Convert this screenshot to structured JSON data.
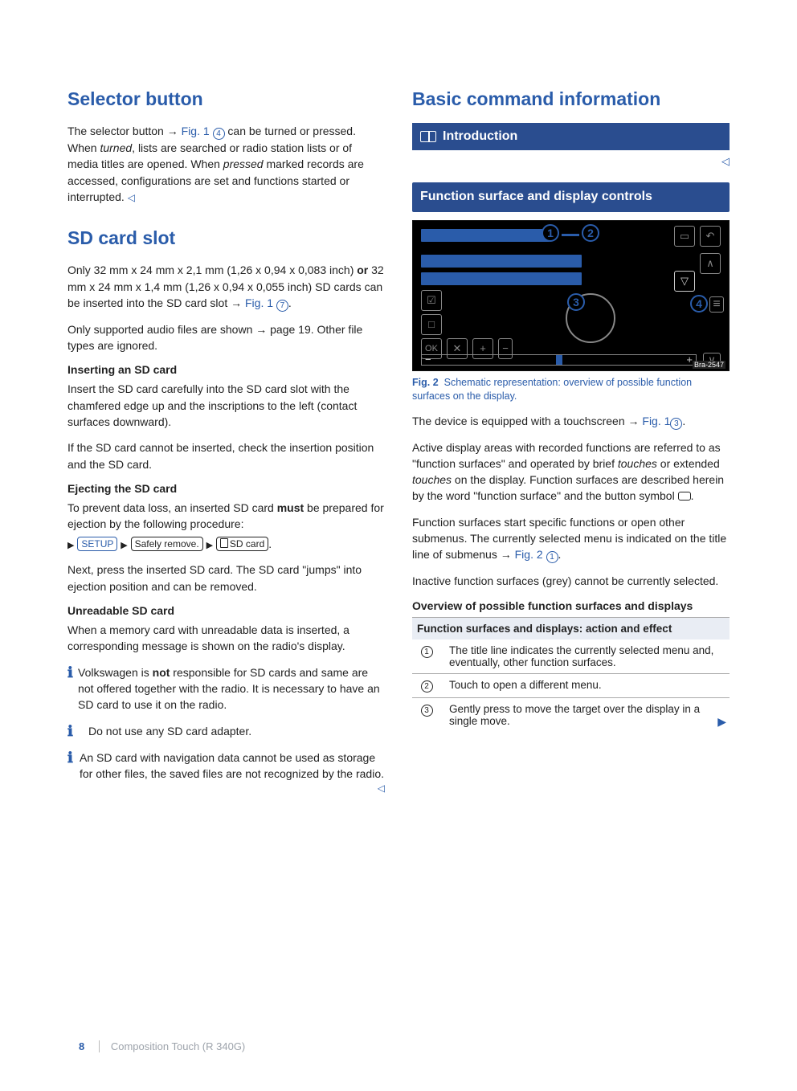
{
  "left": {
    "h_selector": "Selector button",
    "p_selector": "The selector button → Fig. 1 ④ can be turned or pressed. When turned, lists are searched or radio station lists or of media titles are opened. When pressed marked records are accessed, configurations are set and functions started or interrupted.",
    "p_selector_pre": "The selector button → ",
    "p_selector_figref": "Fig. 1",
    "p_selector_circ": "4",
    "p_selector_post": " can be turned or pressed. When ",
    "p_selector_it1": "turned",
    "p_selector_mid": ", lists are searched or radio station lists or of media titles are opened. When ",
    "p_selector_it2": "pressed",
    "p_selector_end": " marked records are accessed, configurations are set and functions started or interrupted. ",
    "h_sd": "SD card slot",
    "p_sd1_a": "Only 32 mm x 24 mm x 2,1 mm (1,26 x 0,94 x 0,083 inch) ",
    "p_sd1_or": "or",
    "p_sd1_b": " 32 mm x 24 mm x 1,4 mm (1,26 x 0,94 x 0,055 inch) SD cards can be inserted into the SD card slot → ",
    "p_sd1_fig": "Fig. 1",
    "p_sd1_circ": "7",
    "p_sd2": "Only supported audio files are shown → page 19. Other file types are ignored.",
    "sub_insert": "Inserting an SD card",
    "p_insert": "Insert the SD card carefully into the SD card slot with the chamfered edge up and the inscriptions to the left (contact surfaces downward).",
    "p_insert2": "If the SD card cannot be inserted, check the insertion position and the SD card.",
    "sub_eject": "Ejecting the SD card",
    "p_eject1_a": "To prevent data loss, an inserted SD card ",
    "p_eject1_must": "must",
    "p_eject1_b": " be prepared for ejection by the following procedure:",
    "btn_setup": "SETUP",
    "btn_safely": "Safely remove.",
    "btn_sdcard": "SD card",
    "p_eject2": "Next, press the inserted SD card. The SD card \"jumps\" into ejection position and can be removed.",
    "sub_unread": "Unreadable SD card",
    "p_unread": "When a memory card with unreadable data is inserted, a corresponding message is shown on the radio's display.",
    "note1_a": "Volkswagen is ",
    "note1_not": "not",
    "note1_b": " responsible for SD cards and same are not offered together with the radio. It is necessary to have an SD card to use it on the radio.",
    "note2": "Do not use any SD card adapter.",
    "note3": "An SD card with navigation data cannot be used as storage for other files, the saved files are not recognized by the radio."
  },
  "right": {
    "h_basic": "Basic command information",
    "intro": "Introduction",
    "sub_func": "Function surface and display controls",
    "fig2_label": "Fig. 2",
    "fig2_cap": "Schematic representation: overview of possible function surfaces on the display.",
    "fig_nums": {
      "n1": "1",
      "n2": "2",
      "n3": "3",
      "n4": "4"
    },
    "fig_ok": "OK",
    "fig_tag": "Bra-2547",
    "p_dev_a": "The device is equipped with a touchscreen → ",
    "p_dev_fig": "Fig. 1",
    "p_dev_circ": "3",
    "p_active_a": "Active display areas with recorded functions are referred to as \"function surfaces\" and operated by brief ",
    "p_active_it1": "touches",
    "p_active_b": " or extended ",
    "p_active_it2": "touches",
    "p_active_c": " on the display. Function surfaces are described herein by the word \"function surface\" and the button symbol ",
    "p_fs_a": "Function surfaces start specific functions or open other submenus. The currently selected menu is indicated on the title line of submenus → ",
    "p_fs_fig": "Fig. 2",
    "p_fs_circ": "1",
    "p_inactive": "Inactive function surfaces (grey) cannot be currently selected.",
    "sub_overview": "Overview of possible function surfaces and displays",
    "thead": "Function surfaces and displays: action and effect",
    "rows": [
      {
        "n": "1",
        "t": "The title line indicates the currently selected menu and, eventually, other function surfaces."
      },
      {
        "n": "2",
        "t": "Touch to open a different menu."
      },
      {
        "n": "3",
        "t": "Gently press to move the target over the display in a single move."
      }
    ]
  },
  "footer": {
    "page": "8",
    "title": "Composition Touch (R 340G)"
  }
}
